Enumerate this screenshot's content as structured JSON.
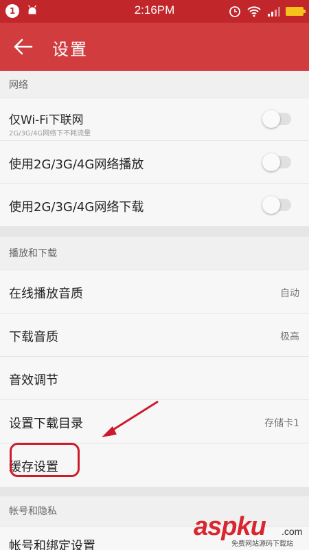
{
  "status_bar": {
    "notification_count": "1",
    "time": "2:16PM"
  },
  "app_bar": {
    "title": "设置"
  },
  "sections": {
    "network": {
      "header": "网络",
      "wifi_only": {
        "label": "仅Wi-Fi下联网",
        "sub": "2G/3G/4G网络下不耗流量",
        "enabled": false
      },
      "mobile_play": {
        "label": "使用2G/3G/4G网络播放",
        "enabled": false
      },
      "mobile_download": {
        "label": "使用2G/3G/4G网络下载",
        "enabled": false
      }
    },
    "playback": {
      "header": "播放和下载",
      "online_quality": {
        "label": "在线播放音质",
        "value": "自动"
      },
      "download_quality": {
        "label": "下载音质",
        "value": "极高"
      },
      "sound_effect": {
        "label": "音效调节"
      },
      "download_dir": {
        "label": "设置下载目录",
        "value": "存储卡1"
      },
      "cache": {
        "label": "缓存设置"
      }
    },
    "account": {
      "header": "帐号和隐私",
      "binding": {
        "label": "帐号和绑定设置"
      }
    }
  },
  "watermark": {
    "main": "aspku",
    "domain": ".com",
    "sub": "免费网站源码下载站"
  },
  "colors": {
    "status_bar": "#c0262a",
    "app_bar": "#d13c3f",
    "annotation_red": "#cc1a2c"
  }
}
